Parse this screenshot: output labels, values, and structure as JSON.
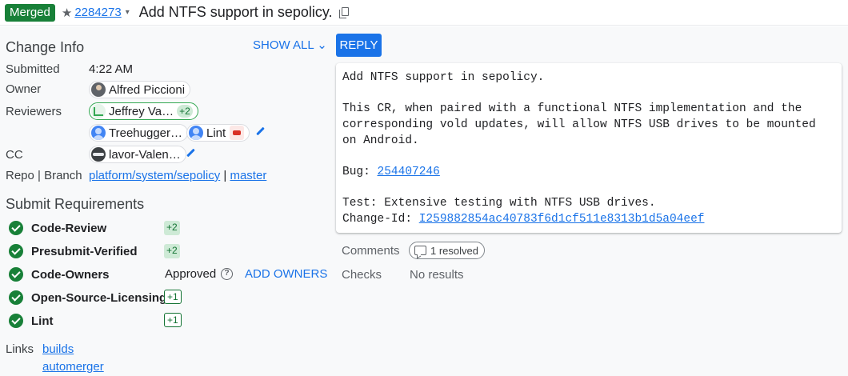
{
  "header": {
    "status": "Merged",
    "star": "★",
    "change_number": "2284273",
    "caret": "▾",
    "subject": "Add NTFS support in sepolicy."
  },
  "change_info": {
    "title": "Change Info",
    "show_all": "SHOW ALL ⌄",
    "submitted_label": "Submitted",
    "submitted_value": "4:22 AM",
    "owner_label": "Owner",
    "owner": "Alfred Piccioni",
    "reviewers_label": "Reviewers",
    "reviewers": [
      {
        "name": "Jeffrey Va…",
        "vote": "+2"
      },
      {
        "name": "Treehugger…"
      },
      {
        "name": "Lint"
      }
    ],
    "cc_label": "CC",
    "cc": "lavor-Valen…",
    "repo_label": "Repo | Branch",
    "repo": "platform/system/sepolicy",
    "separator": "|",
    "branch": "master"
  },
  "submit_requirements": {
    "title": "Submit Requirements",
    "items": [
      {
        "name": "Code-Review",
        "score": "+2"
      },
      {
        "name": "Presubmit-Verified",
        "score": "+2"
      },
      {
        "name": "Code-Owners",
        "status": "Approved",
        "help": "?",
        "action": "ADD OWNERS"
      },
      {
        "name": "Open-Source-Licensing",
        "score": "+1"
      },
      {
        "name": "Lint",
        "score": "+1"
      }
    ]
  },
  "links": {
    "label": "Links",
    "items": [
      "builds",
      "automerger"
    ]
  },
  "message": {
    "reply_label": "REPLY",
    "line1": "Add NTFS support in sepolicy.",
    "line2": "This CR, when paired with a functional NTFS implementation and the",
    "line3": "corresponding vold updates, will allow NTFS USB drives to be mounted",
    "line4": "on Android.",
    "bug_label": "Bug: ",
    "bug_number": "254407246",
    "test_line": "Test: Extensive testing with NTFS USB drives.",
    "change_id_label": "Change-Id: ",
    "change_id": "I259882854ac40783f6d1cf511e8313b1d5a04eef"
  },
  "summary": {
    "comments_label": "Comments",
    "resolved": "1 resolved",
    "checks_label": "Checks",
    "checks_value": "No results"
  },
  "colors": {
    "merged_green": "#188038",
    "link_blue": "#1a73e8",
    "vote_green_bg": "#ceead6"
  }
}
